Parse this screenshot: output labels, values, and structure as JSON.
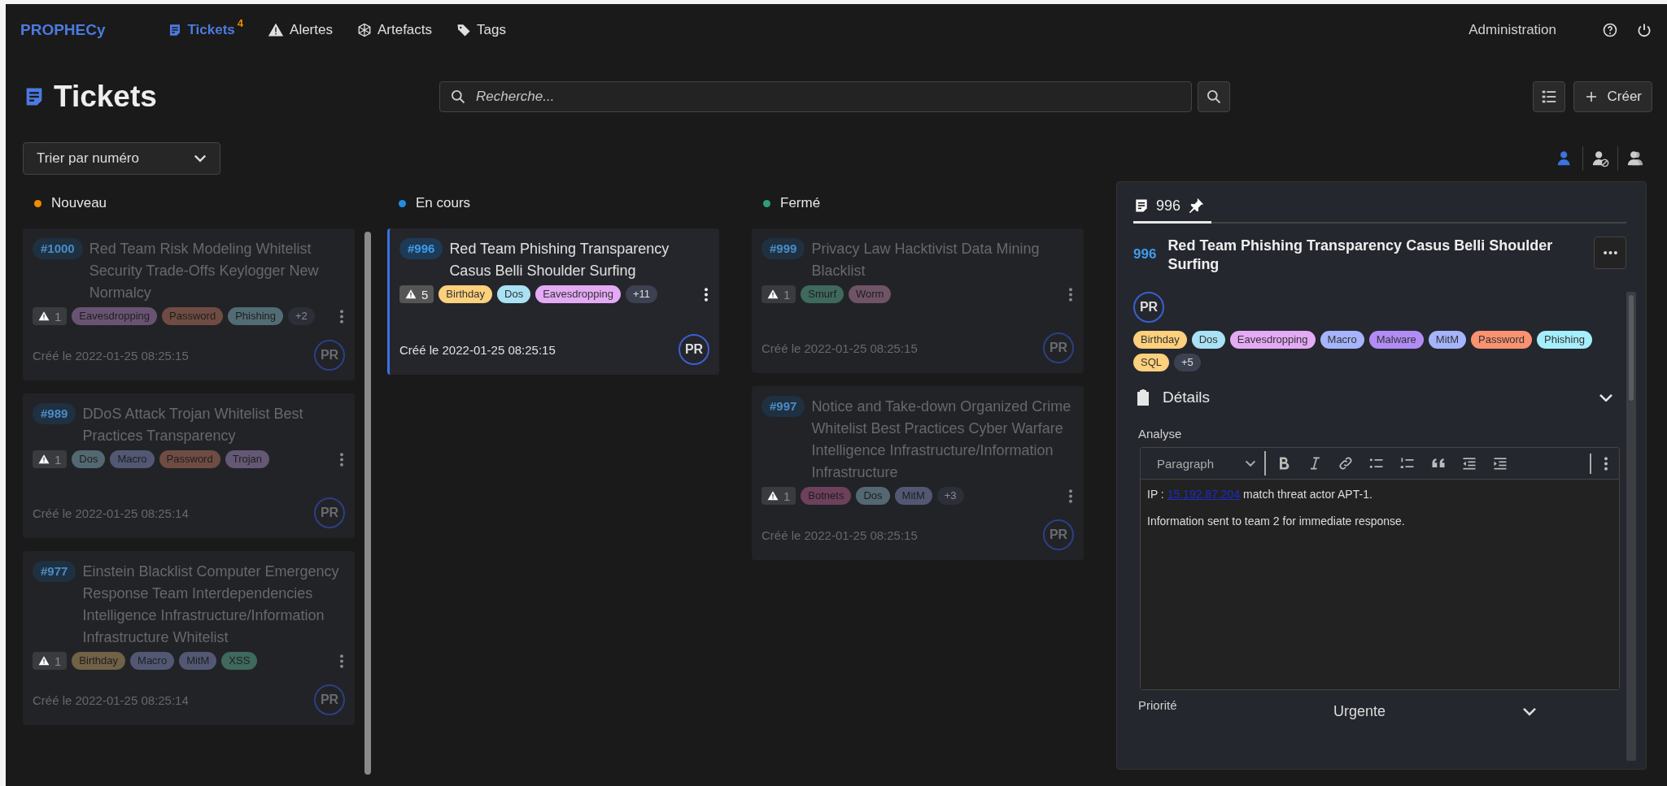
{
  "brand": "PROPHECy",
  "nav": [
    {
      "kind": "tickets",
      "label": "Tickets",
      "badge": "4",
      "selected": true
    },
    {
      "kind": "alerts",
      "label": "Alertes",
      "selected": false
    },
    {
      "kind": "artefacts",
      "label": "Artefacts",
      "selected": false
    },
    {
      "kind": "tags",
      "label": "Tags",
      "selected": false
    }
  ],
  "admin": "Administration",
  "page_title": "Tickets",
  "search": {
    "placeholder": "Recherche..."
  },
  "create_button": "Créer",
  "sort": {
    "value": "Trier par numéro"
  },
  "assignee_filters": [
    {
      "kind": "mine",
      "selected": true
    },
    {
      "kind": "unassigned",
      "selected": false
    },
    {
      "kind": "others",
      "selected": false
    }
  ],
  "columns": [
    {
      "name": "Nouveau",
      "color": "#f08c00",
      "cards": [
        {
          "number": "#1000",
          "title": "Red Team Risk Modeling Whitelist Security Trade-Offs Keylogger New Normalcy",
          "alerts": "1",
          "tags": [
            {
              "label": "Eavesdropping",
              "color": "#685472"
            },
            {
              "label": "Password",
              "color": "#6f4c43"
            },
            {
              "label": "Phishing",
              "color": "#526c74"
            }
          ],
          "more": "+2",
          "created": "Créé le 2022-01-25 08:25:15",
          "assignee": "PR",
          "selected": false
        },
        {
          "number": "#989",
          "title": "DDoS Attack Trojan Whitelist Best Practices Transparency",
          "alerts": "1",
          "tags": [
            {
              "label": "Dos",
              "color": "#536871"
            },
            {
              "label": "Macro",
              "color": "#525874"
            },
            {
              "label": "Password",
              "color": "#6f4c43"
            },
            {
              "label": "Trojan",
              "color": "#645875"
            }
          ],
          "created": "Créé le 2022-01-25 08:25:14",
          "assignee": "PR",
          "selected": false
        },
        {
          "number": "#977",
          "title": "Einstein Blacklist Computer Emergency Response Team Interdependencies Intelligence Infrastructure/Information Infrastructure Whitelist",
          "alerts": "1",
          "tags": [
            {
              "label": "Birthday",
              "color": "#706147"
            },
            {
              "label": "Macro",
              "color": "#525874"
            },
            {
              "label": "MitM",
              "color": "#525874"
            },
            {
              "label": "XSS",
              "color": "#3e695c"
            }
          ],
          "created": "Créé le 2022-01-25 08:25:14",
          "assignee": "PR",
          "selected": false
        }
      ]
    },
    {
      "name": "En cours",
      "color": "#228be6",
      "cards": [
        {
          "number": "#996",
          "title": "Red Team Phishing Transparency Casus Belli Shoulder Surfing",
          "alerts": "5",
          "tags": [
            {
              "label": "Birthday",
              "color": "#fcd07c"
            },
            {
              "label": "Dos",
              "color": "#a8e2f4"
            },
            {
              "label": "Eavesdropping",
              "color": "#e5aaf5"
            }
          ],
          "more": "+11",
          "created": "Créé le 2022-01-25 08:25:15",
          "assignee": "PR",
          "selected": true
        }
      ]
    },
    {
      "name": "Fermé",
      "color": "#2f9e73",
      "cards": [
        {
          "number": "#999",
          "title": "Privacy Law Hacktivist Data Mining Blacklist",
          "alerts": "1",
          "tags": [
            {
              "label": "Smurf",
              "color": "#3e695c"
            },
            {
              "label": "Worm",
              "color": "#6f5366"
            }
          ],
          "created": "Créé le 2022-01-25 08:25:15",
          "assignee": "PR",
          "selected": false
        },
        {
          "number": "#997",
          "title": "Notice and Take-down Organized Crime Whitelist Best Practices Cyber Warfare Intelligence Infrastructure/Information Infrastructure",
          "alerts": "1",
          "tags": [
            {
              "label": "Botnets",
              "color": "#6d405c"
            },
            {
              "label": "Dos",
              "color": "#536871"
            },
            {
              "label": "MitM",
              "color": "#525874"
            }
          ],
          "more": "+3",
          "created": "Créé le 2022-01-25 08:25:15",
          "assignee": "PR",
          "selected": false
        }
      ]
    }
  ],
  "panel": {
    "tab": "996",
    "number": "996",
    "title": "Red Team Phishing Transparency Casus Belli Shoulder Surfing",
    "assignee": "PR",
    "tags": [
      {
        "label": "Birthday",
        "color": "#fcd07c"
      },
      {
        "label": "Dos",
        "color": "#a8e2f4"
      },
      {
        "label": "Eavesdropping",
        "color": "#e5aaf5"
      },
      {
        "label": "Macro",
        "color": "#a5b4fc"
      },
      {
        "label": "Malware",
        "color": "#b18cf7"
      },
      {
        "label": "MitM",
        "color": "#a5b4fc"
      },
      {
        "label": "Password",
        "color": "#f99270"
      },
      {
        "label": "Phishing",
        "color": "#a5eefc"
      },
      {
        "label": "SQL",
        "color": "#fcd07c"
      }
    ],
    "more": "+5",
    "section": "Détails",
    "expanded": true,
    "analysis_label": "Analyse",
    "editor": {
      "block_type": "Paragraph",
      "paragraphs": [
        {
          "before": "IP : ",
          "link": "15.192.87.204",
          "after": " match threat actor APT-1."
        },
        {
          "before": "Information sent to team 2 for immediate response."
        }
      ]
    },
    "priority": {
      "label": "Priorité",
      "value": "Urgente"
    }
  }
}
